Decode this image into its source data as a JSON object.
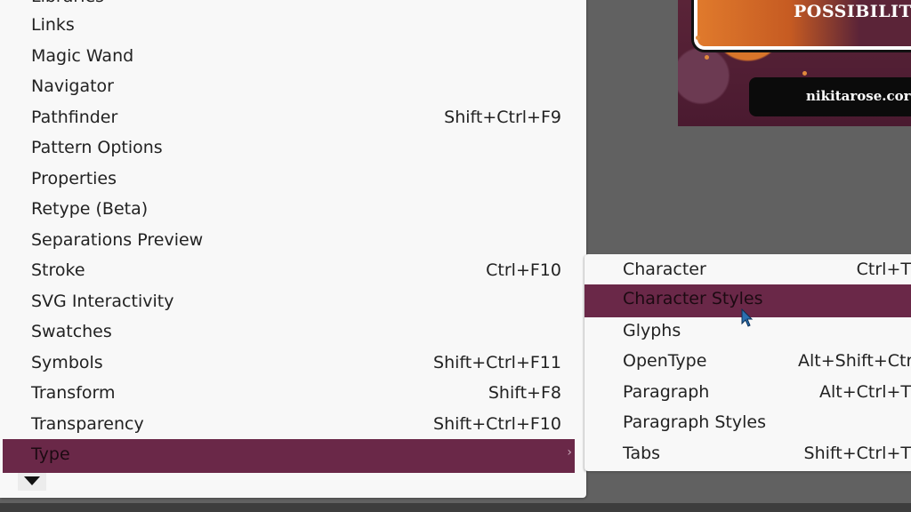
{
  "artwork": {
    "title_text": "POSSIBILITI",
    "url_text": "nikitarose.cor"
  },
  "window_menu": {
    "items": [
      {
        "label": "Libraries",
        "shortcut": ""
      },
      {
        "label": "Links",
        "shortcut": ""
      },
      {
        "label": "Magic Wand",
        "shortcut": ""
      },
      {
        "label": "Navigator",
        "shortcut": ""
      },
      {
        "label": "Pathfinder",
        "shortcut": "Shift+Ctrl+F9"
      },
      {
        "label": "Pattern Options",
        "shortcut": ""
      },
      {
        "label": "Properties",
        "shortcut": ""
      },
      {
        "label": "Retype (Beta)",
        "shortcut": ""
      },
      {
        "label": "Separations Preview",
        "shortcut": ""
      },
      {
        "label": "Stroke",
        "shortcut": "Ctrl+F10"
      },
      {
        "label": "SVG Interactivity",
        "shortcut": ""
      },
      {
        "label": "Swatches",
        "shortcut": ""
      },
      {
        "label": "Symbols",
        "shortcut": "Shift+Ctrl+F11"
      },
      {
        "label": "Transform",
        "shortcut": "Shift+F8"
      },
      {
        "label": "Transparency",
        "shortcut": "Shift+Ctrl+F10"
      },
      {
        "label": "Type",
        "shortcut": "",
        "submenu_arrow": "›",
        "active": true
      }
    ],
    "scroll_indicator": "scroll-down"
  },
  "type_submenu": {
    "items": [
      {
        "label": "Character",
        "shortcut": "Ctrl+T"
      },
      {
        "label": "Character Styles",
        "shortcut": "",
        "active": true
      },
      {
        "label": "Glyphs",
        "shortcut": ""
      },
      {
        "label": "OpenType",
        "shortcut": "Alt+Shift+Ctrl+T"
      },
      {
        "label": "Paragraph",
        "shortcut": "Alt+Ctrl+T"
      },
      {
        "label": "Paragraph Styles",
        "shortcut": ""
      },
      {
        "label": "Tabs",
        "shortcut": "Shift+Ctrl+T"
      }
    ]
  },
  "colors": {
    "highlight": "#6a2848",
    "menu_bg": "#f8f8f8",
    "canvas_bg": "#616161"
  }
}
